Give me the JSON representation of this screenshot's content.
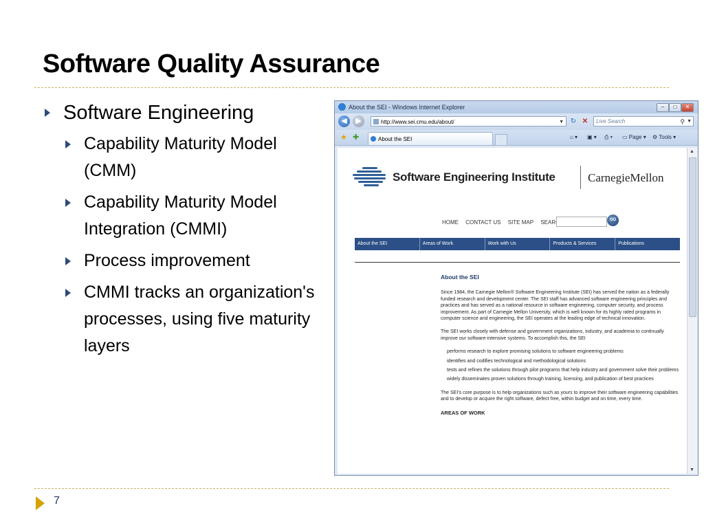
{
  "slide": {
    "title": "Software Quality Assurance",
    "bullets": [
      {
        "level": 1,
        "text": "Software Engineering"
      },
      {
        "level": 2,
        "text": "Capability Maturity Model (CMM)"
      },
      {
        "level": 2,
        "text": "Capability Maturity Model Integration (CMMI)"
      },
      {
        "level": 2,
        "text": "Process improvement"
      },
      {
        "level": 2,
        "text": "CMMI tracks an organization's processes, using five maturity layers"
      }
    ],
    "page_number": "7"
  },
  "browser": {
    "window_title": "About the SEI - Windows Internet Explorer",
    "address": "http://www.sei.cmu.edu/about/",
    "search_placeholder": "Live Search",
    "tab_title": "About the SEI",
    "commands": {
      "page": "Page",
      "tools": "Tools"
    }
  },
  "webpage": {
    "org_name": "Software Engineering Institute",
    "university": "CarnegieMellon",
    "top_nav": [
      "HOME",
      "CONTACT US",
      "SITE MAP",
      "SEARCH"
    ],
    "go_label": "GO",
    "menu": [
      "About the SEI",
      "Areas of Work",
      "Work with Us",
      "Products & Services",
      "Publications"
    ],
    "heading": "About the SEI",
    "para1": "Since 1984, the Carnegie Mellon® Software Engineering Institute (SEI) has served the nation as a federally funded research and development center. The SEI staff has advanced software engineering principles and practices and has served as a national resource in software engineering, computer security, and process improvement. As part of Carnegie Mellon University, which is well known for its highly rated programs in computer science and engineering, the SEI operates at the leading edge of technical innovation.",
    "para2": "The SEI works closely with defense and government organizations, industry, and academia to continually improve our software-intensive systems. To accomplish this, the SEI",
    "list": [
      "performs research to explore promising solutions to software engineering problems",
      "identifies and codifies technological and methodological solutions",
      "tests and refines the solutions through pilot programs that help industry and government solve their problems",
      "widely disseminates proven solutions through training, licensing, and publication of best practices"
    ],
    "para3": "The SEI's core purpose is to help organizations such as yours to improve their software engineering capabilities and to develop or acquire the right software, defect free, within budget and on time, every time.",
    "subheading": "AREAS OF WORK"
  }
}
